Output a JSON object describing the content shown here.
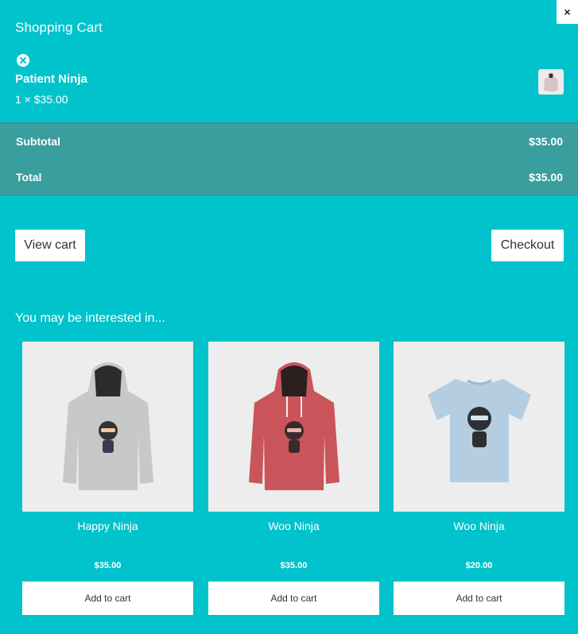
{
  "panel": {
    "close_label": "×",
    "title": "Shopping Cart"
  },
  "cart_item": {
    "name": "Patient Ninja",
    "quantity_price": "1 × $35.00",
    "remove_icon": "remove-circle-icon",
    "thumbnail_color": "#d9c3c6"
  },
  "totals": {
    "subtotal_label": "Subtotal",
    "subtotal_value": "$35.00",
    "total_label": "Total",
    "total_value": "$35.00"
  },
  "actions": {
    "view_cart": "View cart",
    "checkout": "Checkout"
  },
  "recommendations": {
    "heading": "You may be interested in...",
    "products": [
      {
        "name": "Happy Ninja",
        "price": "$35.00",
        "button": "Add to cart",
        "type": "hoodie",
        "color": "#c8c8c8"
      },
      {
        "name": "Woo Ninja",
        "price": "$35.00",
        "button": "Add to cart",
        "type": "hoodie",
        "color": "#c9555b"
      },
      {
        "name": "Woo Ninja",
        "price": "$20.00",
        "button": "Add to cart",
        "type": "tshirt",
        "color": "#b5cde0"
      }
    ]
  },
  "colors": {
    "background": "#00c3cc",
    "totals_band": "#3a9d9e",
    "button_bg": "#ffffff"
  }
}
